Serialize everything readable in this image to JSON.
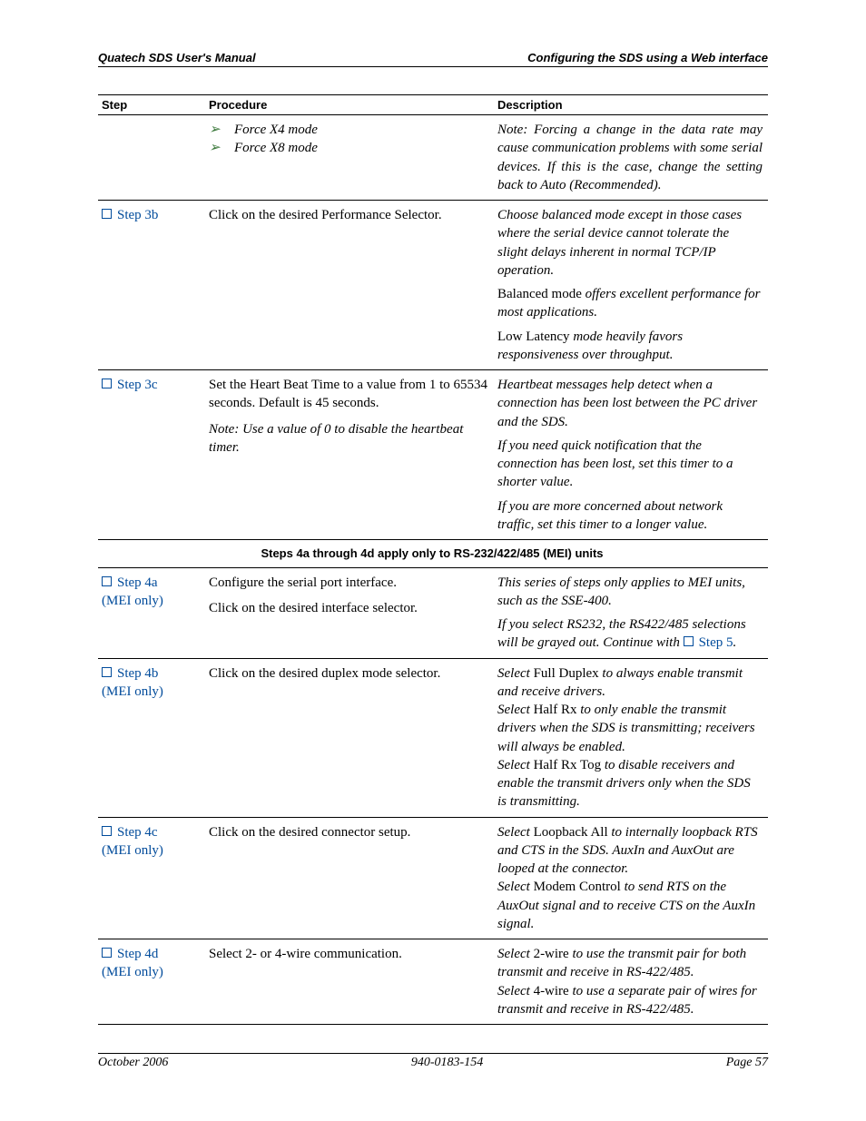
{
  "header": {
    "left": "Quatech SDS User's Manual",
    "right": "Configuring the SDS using a Web interface"
  },
  "table": {
    "headers": {
      "step": "Step",
      "procedure": "Procedure",
      "description": "Description"
    },
    "top_row": {
      "bullets": [
        "Force X4 mode",
        "Force X8 mode"
      ],
      "desc": "Note: Forcing a change in the data rate may cause communication problems with some serial devices. If this is the case, change the setting back to Auto (Recommended)."
    },
    "rows": [
      {
        "step": "Step 3b",
        "mei": "",
        "proc": [
          {
            "t": "Click on the desired Performance Selector."
          }
        ],
        "desc_html": "<p><span class='italic'>Choose balanced mode except in those cases where the serial device cannot tolerate the slight delays inherent in normal TCP/IP operation.</span></p><p><span class='term'>Balanced mode</span> <span class='italic'>offers excellent performance for most applications.</span></p><p><span class='term'>Low Latency</span> <span class='italic'>mode heavily favors responsiveness over throughput.</span></p>"
      },
      {
        "step": "Step 3c",
        "mei": "",
        "proc": [
          {
            "t": "Set the Heart Beat Time to a value from 1 to 65534 seconds. Default is 45 seconds."
          },
          {
            "t": "Note: Use a value of 0 to disable the heartbeat timer.",
            "cls": "note"
          }
        ],
        "desc_html": "<p><span class='italic'>Heartbeat messages help detect when a connection has been lost between the PC driver and the SDS.</span></p><p><span class='italic'>If you need quick notification that the connection has been lost, set this timer to a shorter value.</span></p><p><span class='italic'>If you are more concerned about network traffic, set this timer to a longer value.</span></p>"
      }
    ],
    "section_header": "Steps 4a through 4d apply only to RS-232/422/485 (MEI) units",
    "mei_rows": [
      {
        "step": "Step 4a",
        "mei": "(MEI only)",
        "proc": [
          {
            "t": "Configure the serial port interface."
          },
          {
            "t": "Click on the desired interface selector."
          }
        ],
        "desc_html": "<p><span class='italic'>This series of steps only applies to MEI units, such as the SSE-400.</span></p><p><span class='italic'>If you select RS232, the RS422/485 selections will be grayed out. Continue with </span><span class='checkbox'></span><span class='step-link'>Step 5</span><span class='italic'>.</span></p>"
      },
      {
        "step": "Step 4b",
        "mei": "(MEI only)",
        "proc": [
          {
            "t": "Click on the desired duplex mode selector."
          }
        ],
        "desc_html": "<p><span class='italic'>Select </span><span class='term'>Full Duplex</span><span class='italic'> to always enable transmit and receive drivers.</span><br><span class='italic'>Select </span><span class='term'>Half Rx</span><span class='italic'> to only enable the transmit drivers when the SDS is transmitting; receivers will always be enabled.</span><br><span class='italic'>Select </span><span class='term'>Half Rx Tog</span><span class='italic'> to disable receivers and enable the transmit drivers only when the SDS is transmitting.</span></p>"
      },
      {
        "step": "Step 4c",
        "mei": "(MEI only)",
        "proc": [
          {
            "t": "Click on the desired connector setup."
          }
        ],
        "desc_html": "<p><span class='italic'>Select </span><span class='term'>Loopback All</span><span class='italic'> to internally loopback RTS and CTS in the SDS. AuxIn and AuxOut are looped at the connector.</span><br><span class='italic'>Select </span><span class='term'>Modem Control</span><span class='italic'> to send RTS on the AuxOut signal and to receive CTS on the AuxIn signal.</span></p>"
      },
      {
        "step": "Step 4d",
        "mei": "(MEI only)",
        "proc": [
          {
            "t": "Select 2- or 4-wire communication."
          }
        ],
        "desc_html": "<p><span class='italic'>Select </span><span class='term'>2-wire</span><span class='italic'> to use the transmit pair for both transmit and receive in RS-422/485.</span><br><span class='italic'>Select </span><span class='term'>4-wire</span><span class='italic'> to use a separate pair of wires for transmit and receive in RS-422/485.</span></p>"
      }
    ]
  },
  "footer": {
    "left": "October 2006",
    "center": "940-0183-154",
    "right": "Page 57"
  }
}
